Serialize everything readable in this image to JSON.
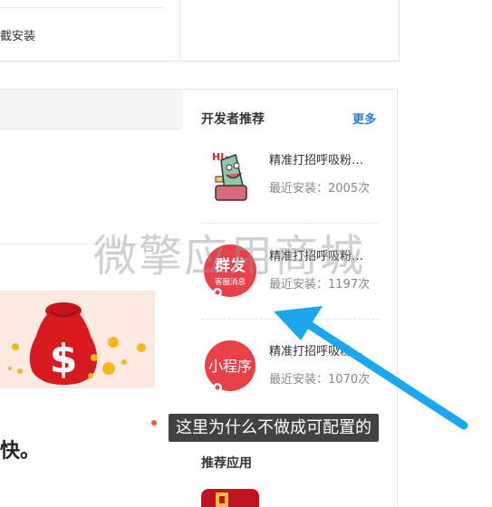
{
  "top_card": {
    "text": "截安装"
  },
  "main": {
    "bottom_text": "快。"
  },
  "sidebar": {
    "title": "开发者推荐",
    "more_label": "更多",
    "apps": [
      {
        "name": "精准打招呼吸粉…",
        "installs": "最近安装：2005次",
        "icon": "hi-cartoon-icon"
      },
      {
        "name": "精准打招呼吸粉…",
        "installs": "最近安装：1197次",
        "icon": "group-message-icon",
        "icon_title": "群发",
        "icon_sub": "客服消息"
      },
      {
        "name": "精准打招呼吸粉…",
        "installs": "最近安装：1070次",
        "icon": "mini-program-icon",
        "icon_title": "小程序"
      }
    ],
    "rec_title": "推荐应用"
  },
  "watermark": "微擎应用商城",
  "caption": "这里为什么不做成可配置的",
  "colors": {
    "accent": "#2a7cd1",
    "icon_red": "#e8414a",
    "arrow": "#1da6f0",
    "banner_bg": "#fbe9e2"
  }
}
